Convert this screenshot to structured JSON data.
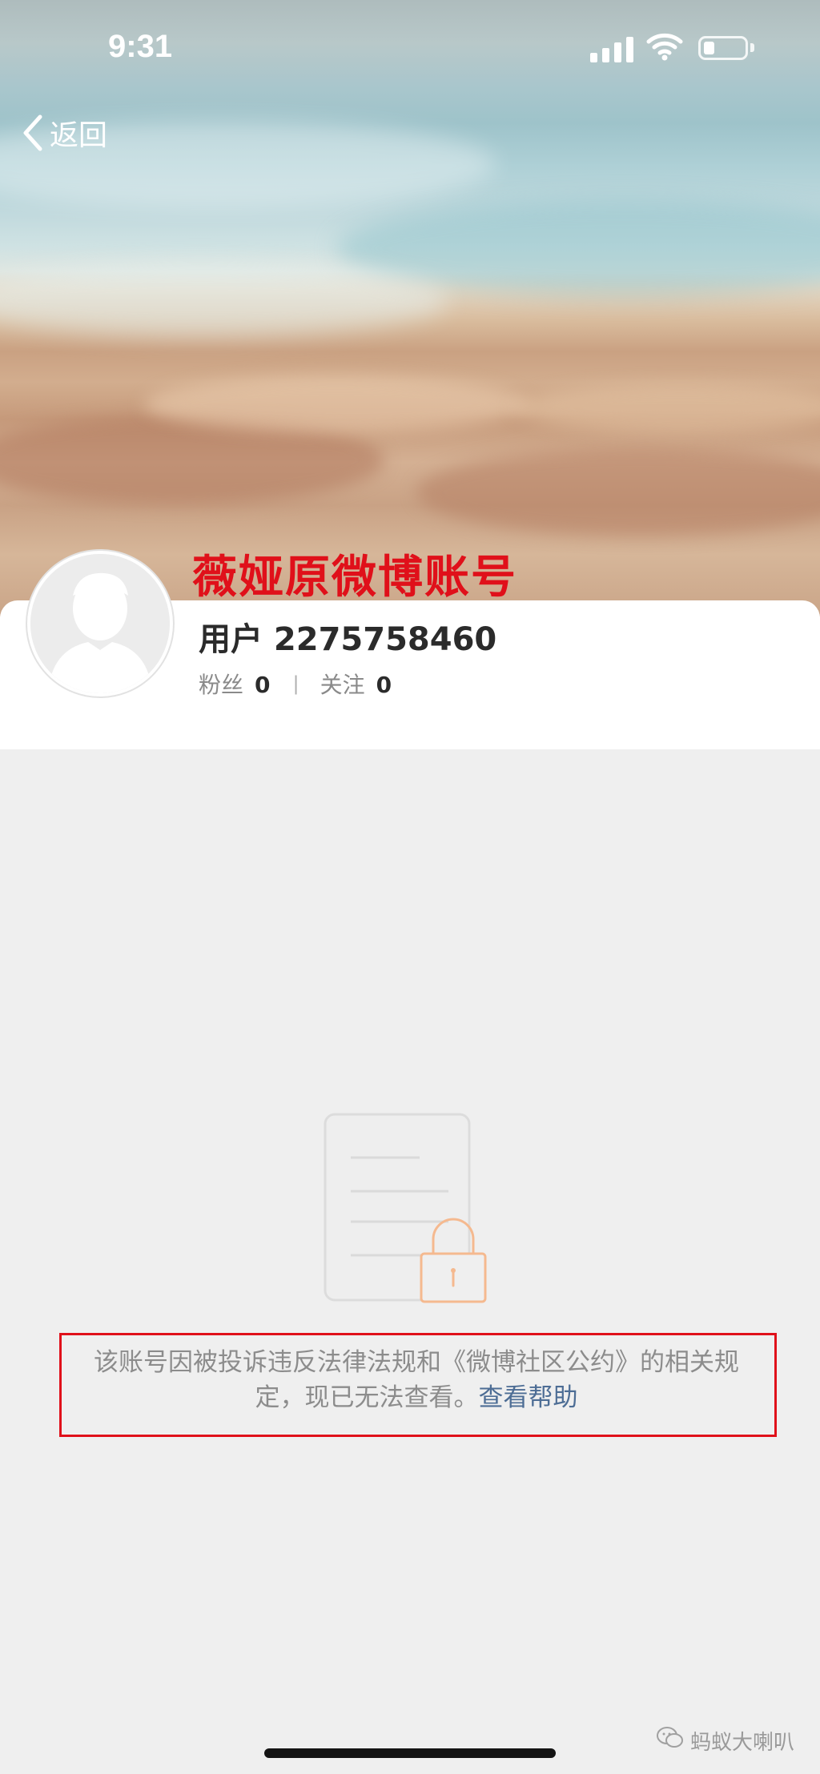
{
  "status_bar": {
    "time": "9:31"
  },
  "nav": {
    "back_label": "返回"
  },
  "overlay": {
    "caption": "薇娅原微博账号"
  },
  "profile": {
    "username": "用户 2275758460",
    "followers_label": "粉丝",
    "followers_count": "0",
    "following_label": "关注",
    "following_count": "0",
    "divider": "|"
  },
  "notice": {
    "message": "该账号因被投诉违反法律法规和《微博社区公约》的相关规定，现已无法查看。",
    "help_link": "查看帮助"
  },
  "watermark": {
    "text": "蚂蚁大喇叭"
  },
  "colors": {
    "caption_red": "#e0101a",
    "link_blue": "#4d6d95",
    "lock_orange": "#f5b98f",
    "page_bg": "#efefef"
  },
  "icons": {
    "back": "chevron-left-icon",
    "signal": "cellular-signal-icon",
    "wifi": "wifi-icon",
    "battery": "battery-icon",
    "avatar": "default-avatar-icon",
    "locked": "locked-document-icon",
    "watermark": "wechat-icon"
  }
}
